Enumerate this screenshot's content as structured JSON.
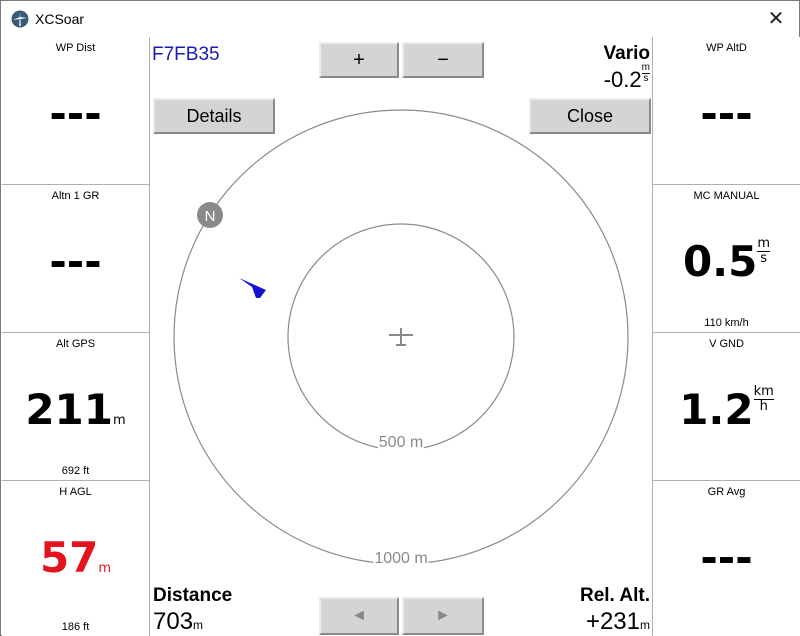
{
  "window": {
    "title": "XCSoar",
    "close_glyph": "✕",
    "app_icon": "xcsoar-logo-icon"
  },
  "infoboxes_left": [
    {
      "title": "WP Dist",
      "value": "---",
      "unit": "",
      "comment": ""
    },
    {
      "title": "Altn 1 GR",
      "value": "---",
      "unit": "",
      "comment": ""
    },
    {
      "title": "Alt GPS",
      "value": "211",
      "unit": "m",
      "comment": "692 ft"
    },
    {
      "title": "H AGL",
      "value": "57",
      "unit": "m",
      "comment": "186 ft",
      "color": "#e4141e"
    }
  ],
  "infoboxes_right": [
    {
      "title": "WP AltD",
      "value": "---",
      "comment": ""
    },
    {
      "title": "MC MANUAL",
      "value": "0.5",
      "unit_num": "m",
      "unit_den": "s",
      "comment": "110 km/h"
    },
    {
      "title": "V GND",
      "value": "1.2",
      "unit_num": "km",
      "unit_den": "h",
      "comment": ""
    },
    {
      "title": "GR Avg",
      "value": "---",
      "comment": ""
    }
  ],
  "map": {
    "target": "F7FB35",
    "zoom_in_label": "+",
    "zoom_out_label": "−",
    "details_label": "Details",
    "close_label": "Close",
    "prev_label": "◄",
    "next_label": "►",
    "vario": {
      "label": "Vario",
      "value": "-0.2",
      "unit_num": "m",
      "unit_den": "s"
    },
    "distance": {
      "label": "Distance",
      "value": "703",
      "unit": "m"
    },
    "rel_alt": {
      "label": "Rel. Alt.",
      "value": "+231",
      "unit": "m"
    },
    "inner_ring_label": "500 m",
    "outer_ring_label": "1000 m",
    "north_label": "N",
    "flarm_color": "#1414d2",
    "ring_color": "#8a8a8a"
  }
}
